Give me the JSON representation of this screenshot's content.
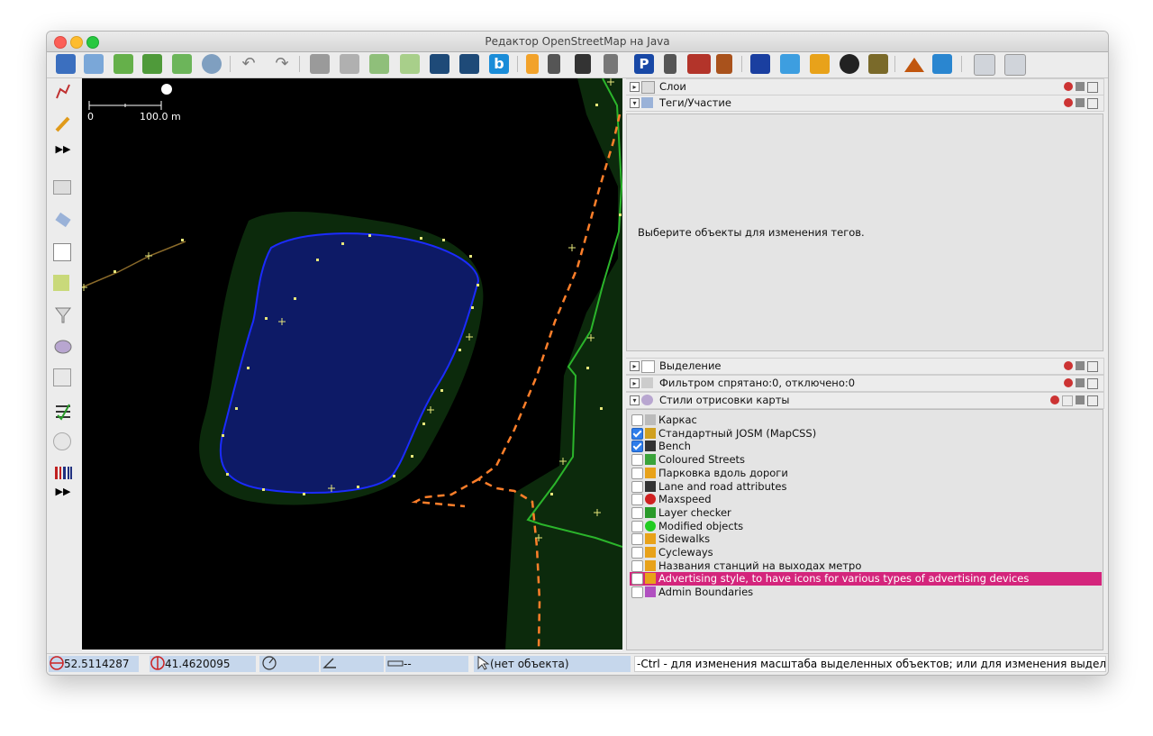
{
  "window": {
    "title": "Редактор OpenStreetMap на Java"
  },
  "toolbar": {
    "buttons": [
      "open-file",
      "save",
      "download",
      "download-data",
      "upload",
      "web-map-service",
      "undo",
      "redo",
      "split-way",
      "combine-way",
      "preferences",
      "zoom-to-data",
      "way-style-1",
      "way-style-2",
      "bing-imagery",
      "road-1",
      "road-2",
      "lane",
      "road-3",
      "parking",
      "tram-stop",
      "wall",
      "railway",
      "information",
      "hotel",
      "shop",
      "sports",
      "factory",
      "peak",
      "water",
      "zoom-in",
      "zoom-out"
    ]
  },
  "left_tools": [
    "select",
    "draw",
    "more",
    "layers",
    "tags",
    "relations",
    "imagery",
    "filter",
    "map-paint",
    "validator",
    "todo",
    "geo",
    "barcode",
    "more"
  ],
  "map": {
    "scale_start": "0",
    "scale_label": "100.0 m",
    "colors": {
      "water_fill": "#0d1a66",
      "water_outline": "#1b2bff",
      "buffer": "#0c2a0c",
      "path": "#ff7f2a",
      "green_way": "#2bb52b",
      "brown_way": "#8a6a2a"
    }
  },
  "panels": {
    "layers_title": "Слои",
    "tags_title": "Теги/Участие",
    "tags_empty": "Выберите объекты для изменения тегов.",
    "selection_title": "Выделение",
    "filter_title": "Фильтром спрятано:0, отключено:0",
    "styles_title": "Стили отрисовки карты"
  },
  "styles": [
    {
      "label": "Каркас",
      "checked": false,
      "icon": "wireframe-icon"
    },
    {
      "label": "Стандартный JOSM (MapCSS)",
      "checked": true,
      "icon": "josm-icon"
    },
    {
      "label": "Bench",
      "checked": true,
      "icon": "bench-icon"
    },
    {
      "label": "Coloured Streets",
      "checked": false,
      "icon": "coloured-streets-icon"
    },
    {
      "label": "Парковка вдоль дороги",
      "checked": false,
      "icon": "pencil-icon"
    },
    {
      "label": "Lane and road attributes",
      "checked": false,
      "icon": "lane-icon"
    },
    {
      "label": "Maxspeed",
      "checked": false,
      "icon": "maxspeed-icon"
    },
    {
      "label": "Layer checker",
      "checked": false,
      "icon": "layer-checker-icon"
    },
    {
      "label": "Modified objects",
      "checked": false,
      "icon": "green-dot-icon"
    },
    {
      "label": "Sidewalks",
      "checked": false,
      "icon": "pencil-icon"
    },
    {
      "label": "Cycleways",
      "checked": false,
      "icon": "pencil-icon"
    },
    {
      "label": "Названия станций на выходах метро",
      "checked": false,
      "icon": "pencil-icon"
    },
    {
      "label": "Advertising style, to have icons for various types of advertising devices",
      "checked": false,
      "icon": "pencil-icon",
      "selected": true
    },
    {
      "label": "Admin Boundaries",
      "checked": false,
      "icon": "admin-boundaries-icon"
    }
  ],
  "status": {
    "lat": "52.5114287",
    "lon": "41.4620095",
    "distance": "--",
    "object": "(нет объекта)",
    "message": "-Ctrl - для изменения масштаба выделенных объектов; или для изменения выделения"
  }
}
